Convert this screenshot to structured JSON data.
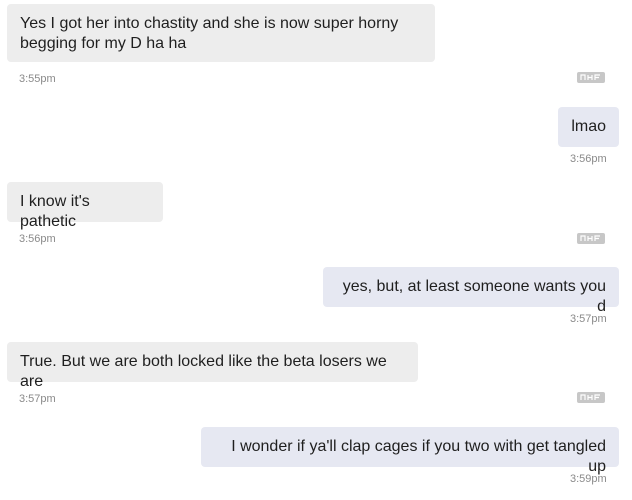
{
  "messages": [
    {
      "direction": "incoming",
      "text": "Yes I got her into chastity and she is now super horny begging for my D ha ha",
      "time": "3:55pm",
      "flagged": true
    },
    {
      "direction": "outgoing",
      "text": "lmao",
      "time": "3:56pm"
    },
    {
      "direction": "incoming",
      "text": "I know it's pathetic",
      "time": "3:56pm",
      "flagged": true
    },
    {
      "direction": "outgoing",
      "text": "yes, but, at least someone wants you d",
      "time": "3:57pm"
    },
    {
      "direction": "incoming",
      "text": "True. But we are both locked like the beta losers we are",
      "time": "3:57pm",
      "flagged": true
    },
    {
      "direction": "outgoing",
      "text": "I wonder if ya'll clap cages if you two with get tangled up",
      "time": "3:59pm"
    }
  ],
  "icons": {
    "report": "report-icon"
  },
  "colors": {
    "incoming_bubble": "#ededed",
    "outgoing_bubble": "#e6e8f2",
    "timestamp": "#8a8a8a",
    "report_icon": "#c7c7c7"
  }
}
